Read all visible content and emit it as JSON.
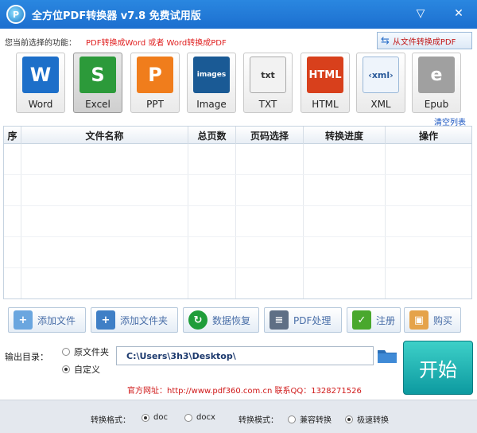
{
  "app": {
    "title": "全方位PDF转换器 v7.8 免费试用版",
    "logo_letter": "P",
    "minimize_glyph": "▽",
    "close_glyph": "✕"
  },
  "function_row": {
    "label": "您当前选择的功能：",
    "value": "PDF转换成Word 或者 Word转换成PDF",
    "from_file_button": "从文件转换成PDF"
  },
  "formats": [
    {
      "label": "Word",
      "glyph": "W",
      "color": "#1d6fc9",
      "selected": false
    },
    {
      "label": "Excel",
      "glyph": "S",
      "color": "#2c9a3a",
      "selected": true
    },
    {
      "label": "PPT",
      "glyph": "P",
      "color": "#f07d1c",
      "selected": false
    },
    {
      "label": "Image",
      "glyph": "images",
      "color": "#1a5a95",
      "selected": false
    },
    {
      "label": "TXT",
      "glyph": "txt",
      "color": "#8a8a8a",
      "selected": false
    },
    {
      "label": "HTML",
      "glyph": "HTML",
      "color": "#d8401c",
      "selected": false
    },
    {
      "label": "XML",
      "glyph": "‹xml›",
      "color": "#4a86c5",
      "selected": false
    },
    {
      "label": "Epub",
      "glyph": "e",
      "color": "#9a9a9a",
      "selected": false
    }
  ],
  "clear_list": "清空列表",
  "table": {
    "headers": [
      "序",
      "文件名称",
      "总页数",
      "页码选择",
      "转换进度",
      "操作"
    ],
    "rows": []
  },
  "toolbar": [
    {
      "label": "添加文件",
      "icon": "add-file",
      "color": "#6aa6df"
    },
    {
      "label": "添加文件夹",
      "icon": "add-folder",
      "color": "#3f7fc6"
    },
    {
      "label": "数据恢复",
      "icon": "data-recovery",
      "color": "#1f9d3a"
    },
    {
      "label": "PDF处理",
      "icon": "pdf-process",
      "color": "#5f6f85"
    },
    {
      "label": "注册",
      "icon": "register-check",
      "color": "#49a82d"
    },
    {
      "label": "购买",
      "icon": "purchase-bag",
      "color": "#e5a34a"
    }
  ],
  "output": {
    "label": "输出目录：",
    "options": [
      {
        "label": "原文件夹",
        "checked": false
      },
      {
        "label": "自定义",
        "checked": true
      }
    ],
    "path": "C:\\Users\\3h3\\Desktop\\",
    "start_label": "开始"
  },
  "site_info": "官方网址：http://www.pdf360.com.cn    联系QQ：1328271526",
  "bottom": {
    "format_label": "转换格式：",
    "format_options": [
      {
        "label": "doc",
        "checked": true
      },
      {
        "label": "docx",
        "checked": false
      }
    ],
    "mode_label": "转换模式：",
    "mode_options": [
      {
        "label": "兼容转换",
        "checked": false
      },
      {
        "label": "极速转换",
        "checked": true
      }
    ]
  }
}
